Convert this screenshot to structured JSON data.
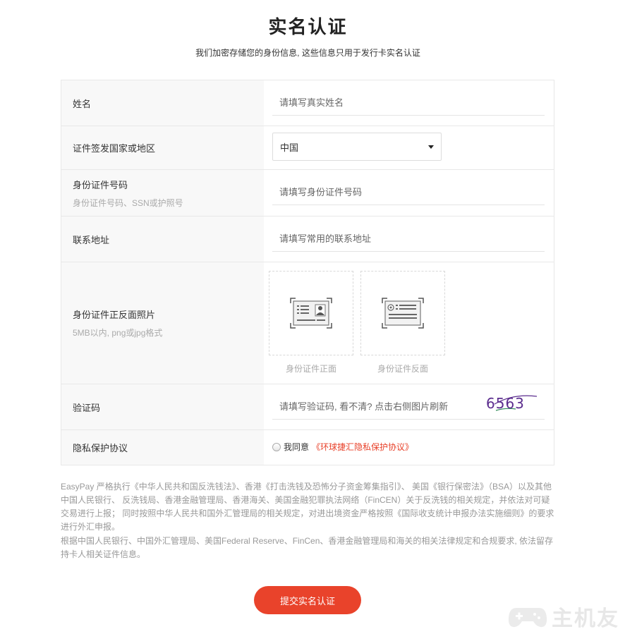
{
  "header": {
    "title": "实名认证",
    "subtitle": "我们加密存储您的身份信息, 这些信息只用于发行卡实名认证"
  },
  "form": {
    "name": {
      "label": "姓名",
      "placeholder": "请填写真实姓名"
    },
    "country": {
      "label": "证件签发国家或地区",
      "selected": "中国"
    },
    "id_number": {
      "label": "身份证件号码",
      "hint": "身份证件号码、SSN或护照号",
      "placeholder": "请填写身份证件号码"
    },
    "address": {
      "label": "联系地址",
      "placeholder": "请填写常用的联系地址"
    },
    "photos": {
      "label": "身份证件正反面照片",
      "hint": "5MB以内, png或jpg格式",
      "front_caption": "身份证件正面",
      "back_caption": "身份证件反面"
    },
    "captcha": {
      "label": "验证码",
      "placeholder": "请填写验证码, 看不清? 点击右侧图片刷新",
      "code": "6563"
    },
    "privacy": {
      "label": "隐私保护协议",
      "agree_text": "我同意",
      "link_text": "《环球捷汇隐私保护协议》"
    }
  },
  "notice": {
    "paragraph1": "EasyPay 严格执行《中华人民共和国反洗钱法》、香港《打击洗钱及恐怖分子资金筹集指引》、 美国《银行保密法》（BSA）以及其他中国人民银行、 反洗钱局、香港金融管理局、香港海关、美国金融犯罪执法网络（FinCEN）关于反洗钱的相关规定，并依法对可疑交易进行上报； 同时按照中华人民共和国外汇管理局的相关规定，对进出境资金严格按照《国际收支统计申报办法实施细则》的要求进行外汇申报。",
    "paragraph2": "根据中国人民银行、中国外汇管理局、美国Federal Reserve、FinCen、香港金融管理局和海关的相关法律规定和合规要求, 依法留存持卡人相关证件信息。"
  },
  "submit_label": "提交实名认证",
  "watermark_text": "主机友",
  "colors": {
    "accent": "#e9432b",
    "link": "#e8412a",
    "label_bg": "#f8f8f8",
    "border": "#e8e8e8",
    "muted_text": "#999999",
    "captcha_ink": "#5b2d8e"
  }
}
